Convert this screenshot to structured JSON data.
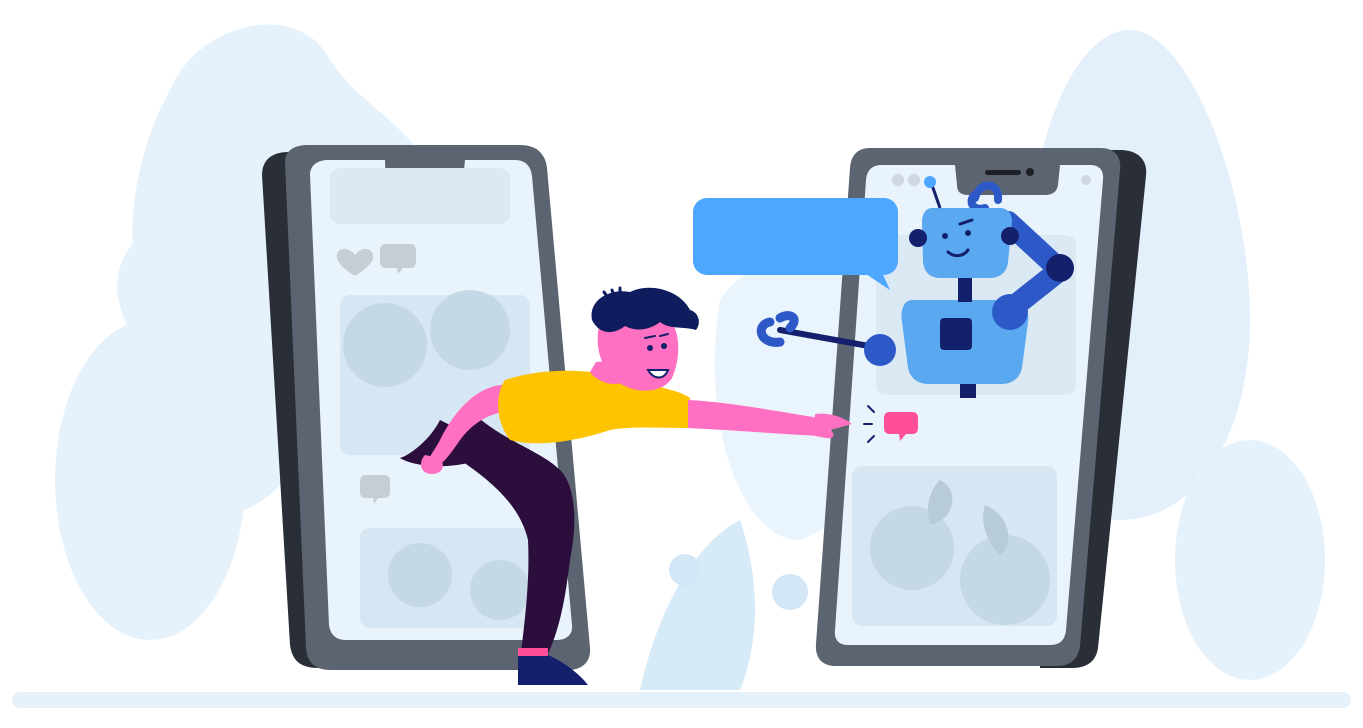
{
  "scene": {
    "subject": "person-reaching-from-phone-to-robot-in-phone",
    "colors": {
      "background": "#ffffff",
      "foliage_light": "#e6f2fb",
      "foliage_mid": "#d7eaf8",
      "phone_dark": "#2a2e37",
      "phone_body": "#5b6470",
      "screen": "#e9f3fb",
      "card": "#dbe9f4",
      "speech_bubble": "#4da6ff",
      "robot_light": "#5aa8f0",
      "robot_dark": "#2d59c8",
      "robot_face_dark": "#14206b",
      "skin": "#ff6fc2",
      "shirt": "#ffc400",
      "pants": "#2b0e3c",
      "hair": "#0f1c5e",
      "small_bubble": "#ff4f9a"
    },
    "icons": [
      "heart-icon",
      "comment-icon",
      "comment-icon",
      "small-chat-bubble-icon"
    ]
  }
}
